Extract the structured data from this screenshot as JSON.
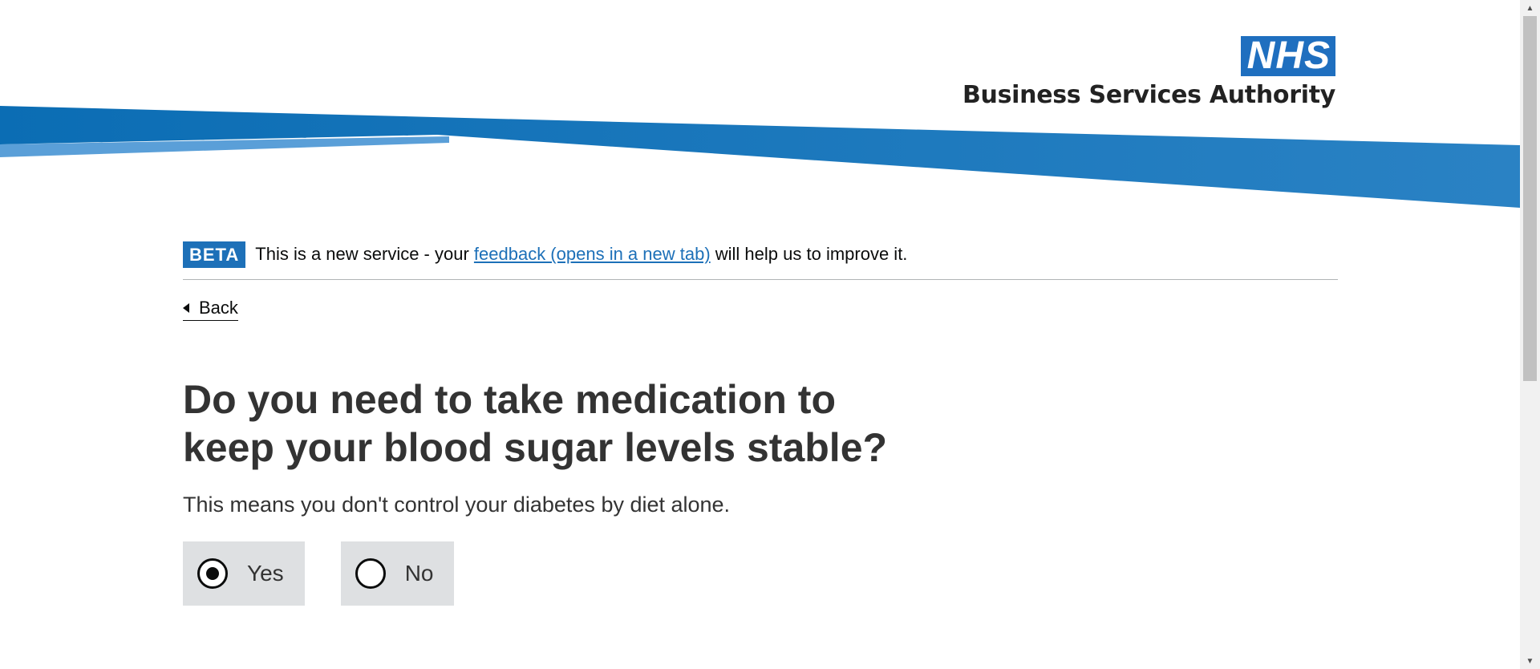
{
  "header": {
    "logo_mark": "NHS",
    "org_name": "Business Services Authority",
    "colors": {
      "swoosh_dark": "#0e6cb5",
      "swoosh_light": "#5a9fd8",
      "logo_blue": "#1f6fbf"
    }
  },
  "phase_banner": {
    "tag": "BETA",
    "text_before": "This is a new service - your ",
    "link_text": "feedback (opens in a new tab)",
    "text_after": " will help us to improve it."
  },
  "back_link": {
    "label": "Back",
    "icon": "chevron-left-icon"
  },
  "question": {
    "title": "Do you need to take medication to keep your blood sugar levels stable?",
    "hint": "This means you don't control your diabetes by diet alone."
  },
  "options": [
    {
      "label": "Yes",
      "selected": true
    },
    {
      "label": "No",
      "selected": false
    }
  ],
  "scrollbar": {
    "up_icon": "chevron-up-icon",
    "down_icon": "chevron-down-icon",
    "up_glyph": "▲",
    "down_glyph": "▼"
  }
}
